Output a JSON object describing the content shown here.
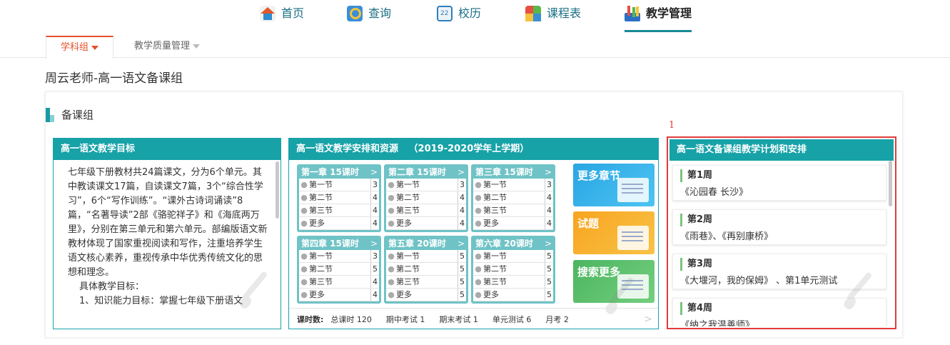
{
  "nav": {
    "items": [
      {
        "label": "首页",
        "icon": "home-icon"
      },
      {
        "label": "查询",
        "icon": "search-icon"
      },
      {
        "label": "校历",
        "icon": "calendar-icon"
      },
      {
        "label": "课程表",
        "icon": "timetable-icon"
      },
      {
        "label": "教学管理",
        "icon": "teaching-manage-icon",
        "active": true
      }
    ]
  },
  "subtabs": [
    {
      "label": "学科组",
      "active": true
    },
    {
      "label": "教学质量管理",
      "active": false
    }
  ],
  "page_title": "周云老师-高一语文备课组",
  "section_title": "备课组",
  "goals": {
    "title": "高一语文教学目标",
    "paragraphs": [
      "七年级下册教材共24篇课文，分为6个单元。其中教读课文17篇，自读课文7篇，3个“综合性学习”，6个“写作训练”。“课外古诗词诵读”8篇，“名著导读”2部《骆驼祥子》和《海底两万里》，分别在第三单元和第六单元。部编版语文新教材体现了国家重视阅读和写作，注重培养学生语文核心素养，重视传承中华优秀传统文化的思想和理念。",
      "具体教学目标：",
      "1、知识能力目标：掌握七年级下册语文"
    ]
  },
  "schedule": {
    "title": "高一语文教学安排和资源",
    "term": "（2019-2020学年上学期）",
    "chapters": [
      {
        "title": "第一章 15课时",
        "rows": [
          {
            "name": "第一节",
            "count": "3"
          },
          {
            "name": "第二节",
            "count": "4"
          },
          {
            "name": "第三节",
            "count": "4"
          },
          {
            "name": "更多",
            "count": "4"
          }
        ]
      },
      {
        "title": "第二章 15课时",
        "rows": [
          {
            "name": "第一节",
            "count": "3"
          },
          {
            "name": "第二节",
            "count": "4"
          },
          {
            "name": "第三节",
            "count": "4"
          },
          {
            "name": "更多",
            "count": "4"
          }
        ]
      },
      {
        "title": "第三章 15课时",
        "rows": [
          {
            "name": "第一节",
            "count": "3"
          },
          {
            "name": "第二节",
            "count": "4"
          },
          {
            "name": "第三节",
            "count": "4"
          },
          {
            "name": "更多",
            "count": "4"
          }
        ]
      },
      {
        "title": "第四章 15课时",
        "rows": [
          {
            "name": "第一节",
            "count": "3"
          },
          {
            "name": "第二节",
            "count": "5"
          },
          {
            "name": "第三节",
            "count": "4"
          },
          {
            "name": "更多",
            "count": "4"
          }
        ]
      },
      {
        "title": "第五章 20课时",
        "rows": [
          {
            "name": "第一节",
            "count": "5"
          },
          {
            "name": "第二节",
            "count": "5"
          },
          {
            "name": "第三节",
            "count": "5"
          },
          {
            "name": "更多",
            "count": "5"
          }
        ]
      },
      {
        "title": "第六章 20课时",
        "rows": [
          {
            "name": "第一节",
            "count": "5"
          },
          {
            "name": "第二节",
            "count": "5"
          },
          {
            "name": "第三节",
            "count": "5"
          },
          {
            "name": "更多",
            "count": "5"
          }
        ]
      }
    ],
    "tiles": {
      "more": "更多章节",
      "test": "试题",
      "search": "搜索更多"
    },
    "stats": {
      "label": "课时数:",
      "items": [
        "总课时 120",
        "期中考试 1",
        "期末考试 1",
        "单元测试 6",
        "月考 2"
      ]
    }
  },
  "plan": {
    "marker": "1",
    "title": "高一语文备课组教学计划和安排",
    "weeks": [
      {
        "week": "第1周",
        "content": "《沁园春 长沙》"
      },
      {
        "week": "第2周",
        "content": "《雨巷》、《再别康桥》"
      },
      {
        "week": "第3周",
        "content": "《大堰河，我的保姆》 、第1单元测试"
      },
      {
        "week": "第4周",
        "content": "《纳之我温善师》"
      }
    ]
  },
  "colors": {
    "accent": "#17a2a8",
    "tab_active": "#e3512c",
    "highlight_border": "#e23a3a"
  }
}
